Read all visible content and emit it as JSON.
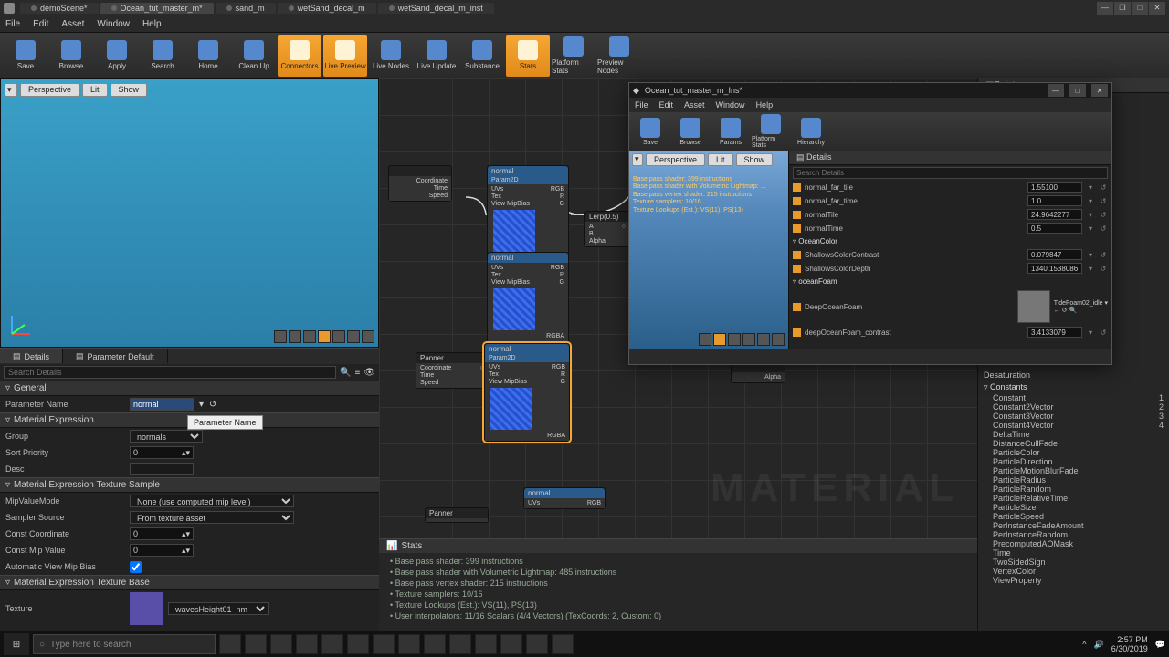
{
  "titlebar": {
    "tabs": [
      "demoScene*",
      "Ocean_tut_master_m*",
      "sand_m",
      "wetSand_decal_m",
      "wetSand_decal_m_inst"
    ],
    "active": 1
  },
  "menu": [
    "File",
    "Edit",
    "Asset",
    "Window",
    "Help"
  ],
  "toolbar": [
    {
      "label": "Save"
    },
    {
      "label": "Browse"
    },
    {
      "label": "Apply"
    },
    {
      "label": "Search"
    },
    {
      "label": "Home"
    },
    {
      "label": "Clean Up"
    },
    {
      "label": "Connectors",
      "orange": true
    },
    {
      "label": "Live Preview",
      "orange": true
    },
    {
      "label": "Live Nodes"
    },
    {
      "label": "Live Update"
    },
    {
      "label": "Substance"
    },
    {
      "label": "Stats",
      "orange": true
    },
    {
      "label": "Platform Stats"
    },
    {
      "label": "Preview Nodes"
    }
  ],
  "viewport": {
    "buttons": [
      "Perspective",
      "Lit",
      "Show"
    ]
  },
  "detailsTabs": [
    "Details",
    "Parameter Default"
  ],
  "searchPlaceholder": "Search Details",
  "general": {
    "header": "General",
    "paramNameLabel": "Parameter Name",
    "paramNameValue": "normal",
    "tooltip": "Parameter Name"
  },
  "materialExpr": {
    "header": "Material Expression",
    "groupLabel": "Group",
    "groupValue": "normals",
    "sortLabel": "Sort Priority",
    "sortValue": "0",
    "descLabel": "Desc",
    "descValue": ""
  },
  "texSample": {
    "header": "Material Expression Texture Sample",
    "mipLabel": "MipValueMode",
    "mipValue": "None (use computed mip level)",
    "samplerLabel": "Sampler Source",
    "samplerValue": "From texture asset",
    "constCoordLabel": "Const Coordinate",
    "constCoord": "0",
    "constMipLabel": "Const Mip Value",
    "constMip": "0",
    "autoBiasLabel": "Automatic View Mip Bias",
    "autoBias": true
  },
  "texBase": {
    "header": "Material Expression Texture Base",
    "textureLabel": "Texture",
    "textureName": "wavesHeight01_nm"
  },
  "stats": {
    "header": "Stats",
    "lines": [
      "Base pass shader: 399 instructions",
      "Base pass shader with Volumetric Lightmap: 485 instructions",
      "Base pass vertex shader: 215 instructions",
      "Texture samplers: 10/16",
      "Texture Lookups (Est.): VS(11), PS(13)",
      "User interpolators: 11/16 Scalars (4/4 Vectors) (TexCoords: 2, Custom: 0)"
    ]
  },
  "instWindow": {
    "title": "Ocean_tut_master_m_Ins*",
    "menu": [
      "File",
      "Edit",
      "Asset",
      "Window",
      "Help"
    ],
    "toolbar": [
      "Save",
      "Browse",
      "Params",
      "Platform Stats",
      "Hierarchy"
    ],
    "vpButtons": [
      "Perspective",
      "Lit",
      "Show"
    ],
    "msg": "Base pass shader: 399 instructions\nBase pass shader with Volumetric Lightmap: ...\nBase pass vertex shader: 215 instructions\nTexture samplers: 10/16\nTexture Lookups (Est.): VS(11), PS(13)",
    "detailsHeader": "Details",
    "searchPlaceholder": "Search Details",
    "rows": [
      {
        "name": "normal_far_tile",
        "val": "1.55100"
      },
      {
        "name": "normal_far_time",
        "val": "1.0"
      },
      {
        "name": "normalTile",
        "val": "24.9642277"
      },
      {
        "name": "normalTime",
        "val": "0.5"
      }
    ],
    "oceanColor": {
      "header": "OceanColor",
      "rows": [
        {
          "name": "ShallowsColorContrast",
          "val": "0.079847"
        },
        {
          "name": "ShallowsColorDepth",
          "val": "1340.1538086"
        }
      ]
    },
    "oceanFoam": {
      "header": "oceanFoam",
      "rows": [
        {
          "name": "DeepOceanFoam",
          "tex": "TideFoam02_idle"
        },
        {
          "name": "deepOceanFoam_contrast",
          "val": "3.4133079"
        }
      ]
    }
  },
  "palette": {
    "header": "Palette",
    "catA": "Desaturation",
    "catB": "Constants",
    "items": [
      {
        "n": "Constant",
        "k": "1"
      },
      {
        "n": "Constant2Vector",
        "k": "2"
      },
      {
        "n": "Constant3Vector",
        "k": "3"
      },
      {
        "n": "Constant4Vector",
        "k": "4"
      },
      {
        "n": "DeltaTime"
      },
      {
        "n": "DistanceCullFade"
      },
      {
        "n": "ParticleColor"
      },
      {
        "n": "ParticleDirection"
      },
      {
        "n": "ParticleMotionBlurFade"
      },
      {
        "n": "ParticleRadius"
      },
      {
        "n": "ParticleRandom"
      },
      {
        "n": "ParticleRelativeTime"
      },
      {
        "n": "ParticleSize"
      },
      {
        "n": "ParticleSpeed"
      },
      {
        "n": "PerInstanceFadeAmount"
      },
      {
        "n": "PerInstanceRandom"
      },
      {
        "n": "PrecomputedAOMask"
      },
      {
        "n": "Time"
      },
      {
        "n": "TwoSidedSign"
      },
      {
        "n": "VertexColor"
      },
      {
        "n": "ViewProperty"
      }
    ]
  },
  "nodes": {
    "normal": "normal",
    "panner": "Panner",
    "param2d": "Param2D",
    "pins": [
      "UVs",
      "Tex",
      "View MipBias",
      "Coordinate",
      "Time",
      "Speed",
      "RGB",
      "R",
      "G",
      "B",
      "A",
      "RGBA",
      "Alpha"
    ],
    "lerp": "Lerp(0.5)"
  },
  "taskbar": {
    "search": "Type here to search",
    "time": "2:57 PM",
    "date": "6/30/2019"
  },
  "materialWm": "MATERIAL"
}
